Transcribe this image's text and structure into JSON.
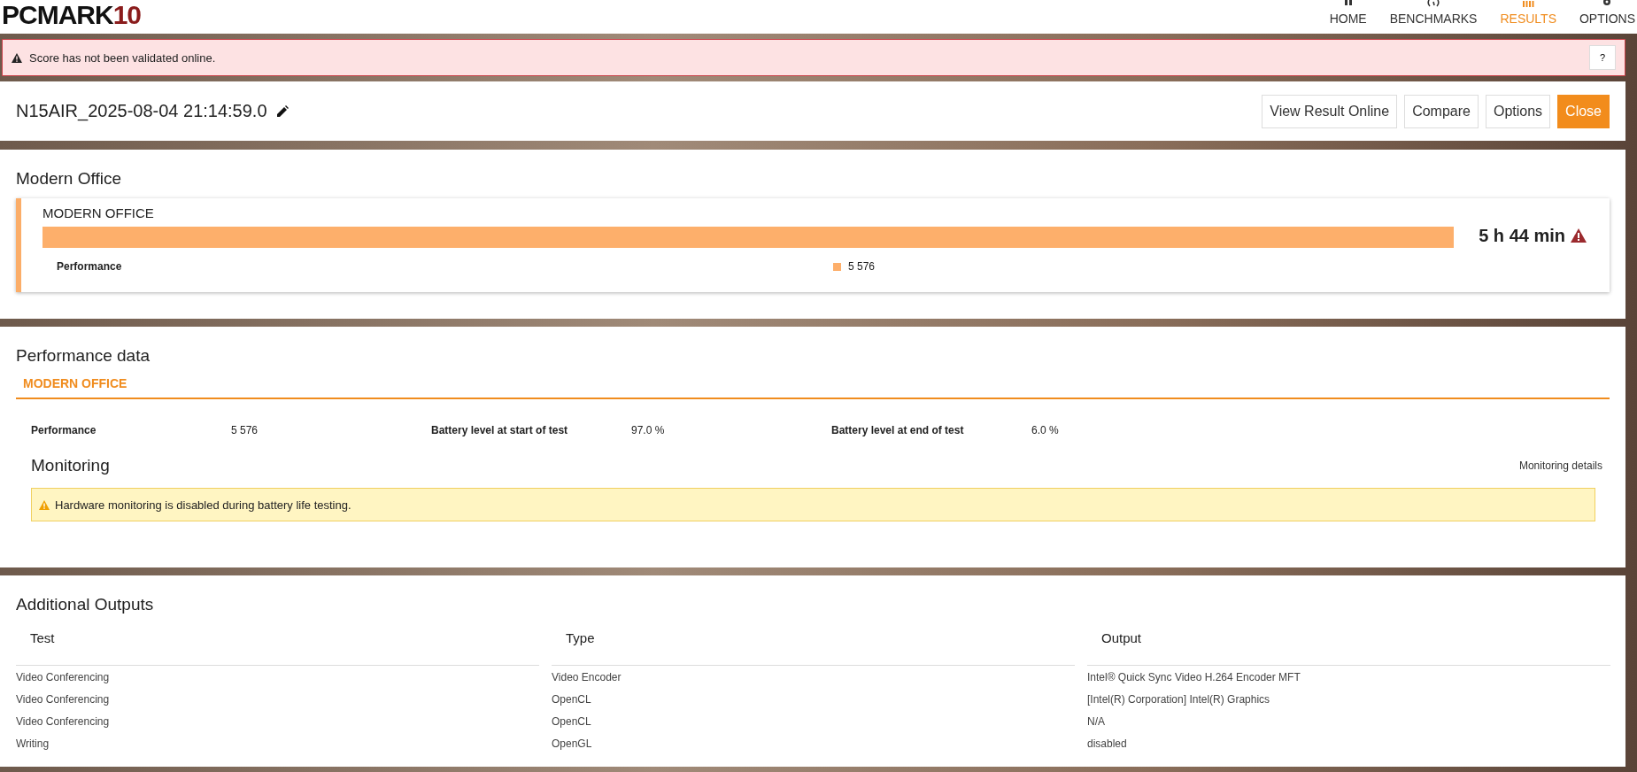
{
  "logo": {
    "text": "PCMARK",
    "suffix": "10"
  },
  "nav": [
    {
      "label": "HOME",
      "selected": false
    },
    {
      "label": "BENCHMARKS",
      "selected": false
    },
    {
      "label": "RESULTS",
      "selected": true
    },
    {
      "label": "OPTIONS",
      "selected": false
    }
  ],
  "alert": {
    "text": "Score has not been validated online.",
    "help": "?"
  },
  "result": {
    "title": "N15AIR_2025-08-04 21:14:59.0",
    "buttons": [
      {
        "label": "View Result Online",
        "primary": false
      },
      {
        "label": "Compare",
        "primary": false
      },
      {
        "label": "Options",
        "primary": false
      },
      {
        "label": "Close",
        "primary": true
      }
    ]
  },
  "modern_office": {
    "heading": "Modern Office",
    "benchmark": "MODERN OFFICE",
    "score": "5 h 44 min",
    "warning": true,
    "sub_label": "Performance",
    "sub_value": "5 576"
  },
  "performance_data": {
    "heading": "Performance data",
    "tabs": [
      {
        "label": "MODERN OFFICE",
        "selected": true
      }
    ],
    "metrics": [
      {
        "label": "Performance",
        "value": "5 576"
      },
      {
        "label": "Battery level at start of test",
        "value": "97.0 %"
      },
      {
        "label": "Battery level at end of test",
        "value": "6.0 %"
      }
    ],
    "monitoring": {
      "heading": "Monitoring",
      "link": "Monitoring details",
      "notice": "Hardware monitoring is disabled during battery life testing."
    }
  },
  "additional_outputs": {
    "heading": "Additional Outputs",
    "columns": [
      "Test",
      "Type",
      "Output"
    ],
    "rows": [
      [
        "Video Conferencing",
        "Video Encoder",
        "Intel® Quick Sync Video H.264 Encoder MFT"
      ],
      [
        "Video Conferencing",
        "OpenCL",
        "[Intel(R) Corporation] Intel(R) Graphics"
      ],
      [
        "Video Conferencing",
        "OpenCL",
        "N/A"
      ],
      [
        "Writing",
        "OpenGL",
        "disabled"
      ]
    ]
  }
}
